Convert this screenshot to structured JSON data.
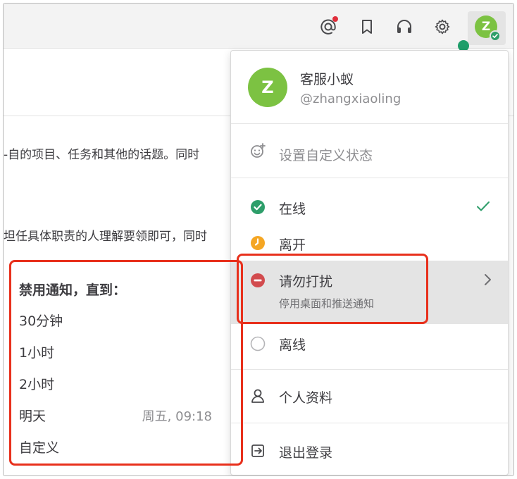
{
  "colors": {
    "accent_green": "#7cc242",
    "status_online": "#2e9e6a",
    "status_away": "#f5a623",
    "status_dnd": "#d24b4e",
    "highlight_red": "#e8301c"
  },
  "topbar": {
    "icons": [
      "at-mention-icon",
      "bookmark-icon",
      "headset-icon",
      "gear-icon"
    ],
    "avatar_initial": "Z"
  },
  "background": {
    "line1": "-自的项目、任务和其他的话题。同时",
    "line2": "坦任具体职责的人理解要领即可，同时"
  },
  "profile": {
    "initial": "Z",
    "name": "客服小蚁",
    "handle": "@zhangxiaoling"
  },
  "menu": {
    "custom_status": "设置自定义状态",
    "online": "在线",
    "away": "离开",
    "dnd": "请勿打扰",
    "dnd_sub": "停用桌面和推送通知",
    "offline": "离线",
    "profile": "个人资料",
    "logout": "退出登录"
  },
  "dnd_submenu": {
    "title": "禁用通知，直到：",
    "options": [
      "30分钟",
      "1小时",
      "2小时",
      "明天",
      "自定义"
    ],
    "tomorrow_time": "周五, 09:18"
  }
}
